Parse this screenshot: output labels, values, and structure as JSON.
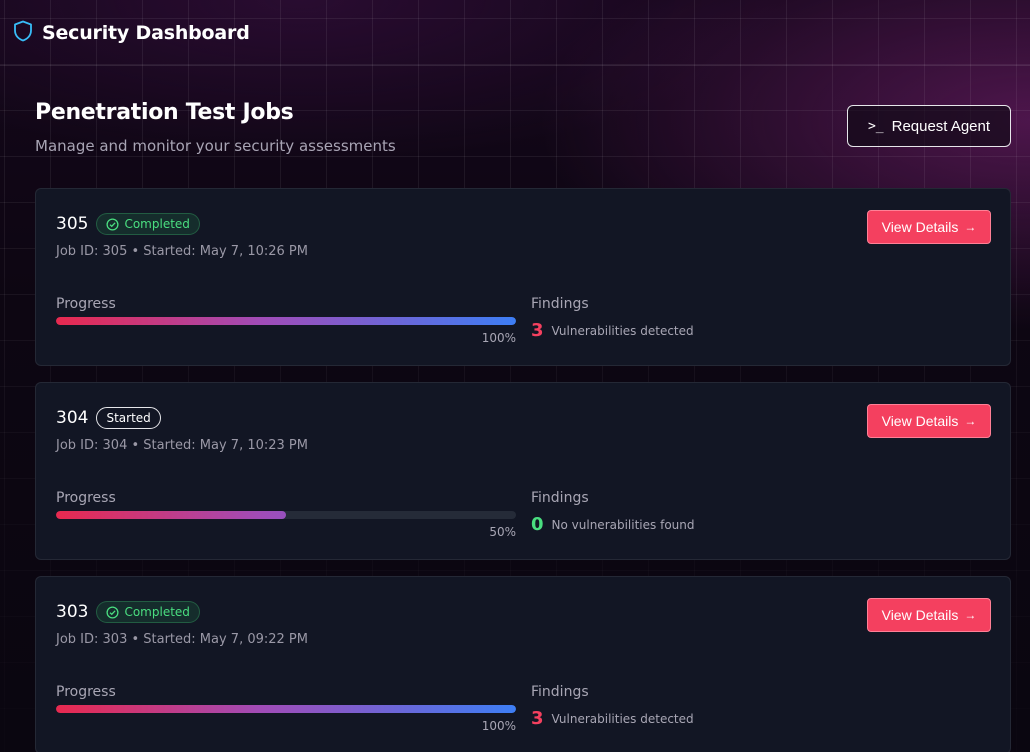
{
  "app": {
    "title": "Security Dashboard",
    "logo_icon": "shield-icon"
  },
  "page": {
    "title": "Penetration Test Jobs",
    "subtitle": "Manage and monitor your security assessments",
    "request_button": {
      "label": "Request Agent",
      "icon": "terminal-prompt-icon"
    }
  },
  "colors": {
    "accent": "#f4405f",
    "success": "#4ade80",
    "card_bg": "#121624"
  },
  "jobs": [
    {
      "name": "305",
      "status": "Completed",
      "status_type": "completed",
      "meta": "Job ID: 305 • Started: May 7, 10:26 PM",
      "view_label": "View Details",
      "progress_label": "Progress",
      "progress": 100,
      "progress_text": "100%",
      "findings_label": "Findings",
      "findings_count": "3",
      "findings_text": "Vulnerabilities detected"
    },
    {
      "name": "304",
      "status": "Started",
      "status_type": "started",
      "meta": "Job ID: 304 • Started: May 7, 10:23 PM",
      "view_label": "View Details",
      "progress_label": "Progress",
      "progress": 50,
      "progress_text": "50%",
      "findings_label": "Findings",
      "findings_count": "0",
      "findings_text": "No vulnerabilities found"
    },
    {
      "name": "303",
      "status": "Completed",
      "status_type": "completed",
      "meta": "Job ID: 303 • Started: May 7, 09:22 PM",
      "view_label": "View Details",
      "progress_label": "Progress",
      "progress": 100,
      "progress_text": "100%",
      "findings_label": "Findings",
      "findings_count": "3",
      "findings_text": "Vulnerabilities detected"
    }
  ]
}
